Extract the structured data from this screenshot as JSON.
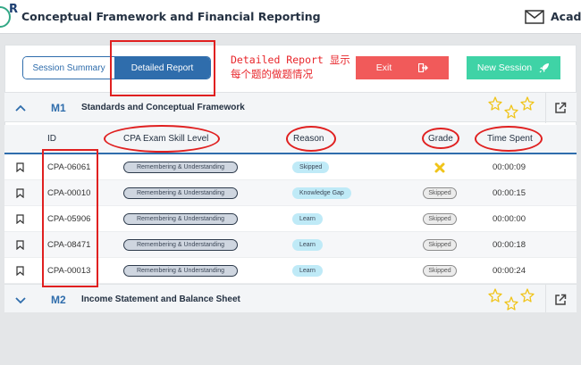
{
  "header": {
    "logo_letter": "R",
    "title": "Conceptual Framework and Financial Reporting",
    "account_label": "Acade"
  },
  "toolbar": {
    "session_summary_label": "Session Summary",
    "detailed_report_label": "Detailed Report",
    "exit_label": "Exit",
    "new_session_label": "New Session"
  },
  "annotation": {
    "line1": "Detailed Report 显示",
    "line2": "每个题的做题情况"
  },
  "modules": [
    {
      "code": "M1",
      "name": "Standards and Conceptual Framework",
      "expanded": true,
      "icon": "chevron-up-icon"
    },
    {
      "code": "M2",
      "name": "Income Statement and Balance Sheet",
      "expanded": false,
      "icon": "chevron-down-icon"
    }
  ],
  "table": {
    "columns": {
      "id": "ID",
      "skill": "CPA Exam Skill Level",
      "reason": "Reason",
      "grade": "Grade",
      "time": "Time Spent"
    },
    "rows": [
      {
        "id": "CPA-06061",
        "skill": "Remembering & Understanding",
        "reason": "Skipped",
        "grade": "",
        "grade_icon": "x-icon",
        "time": "00:00:09"
      },
      {
        "id": "CPA-00010",
        "skill": "Remembering & Understanding",
        "reason": "Knowledge Gap",
        "grade": "Skipped",
        "time": "00:00:15"
      },
      {
        "id": "CPA-05906",
        "skill": "Remembering & Understanding",
        "reason": "Learn",
        "grade": "Skipped",
        "time": "00:00:00"
      },
      {
        "id": "CPA-08471",
        "skill": "Remembering & Understanding",
        "reason": "Learn",
        "grade": "Skipped",
        "time": "00:00:18"
      },
      {
        "id": "CPA-00013",
        "skill": "Remembering & Understanding",
        "reason": "Learn",
        "grade": "Skipped",
        "time": "00:00:24"
      }
    ]
  },
  "colors": {
    "primary": "#2f6dac",
    "exit": "#f15a5a",
    "new_session": "#3fd3a6",
    "annotation": "#e02020",
    "star": "#f0c419",
    "grade_x": "#f0c419"
  },
  "icons": {
    "mail": "mail-icon",
    "exit": "exit-icon",
    "new_session": "rocket-icon",
    "bookmark": "bookmark-icon",
    "stars": "stars-icon",
    "external_link": "external-link-icon"
  }
}
